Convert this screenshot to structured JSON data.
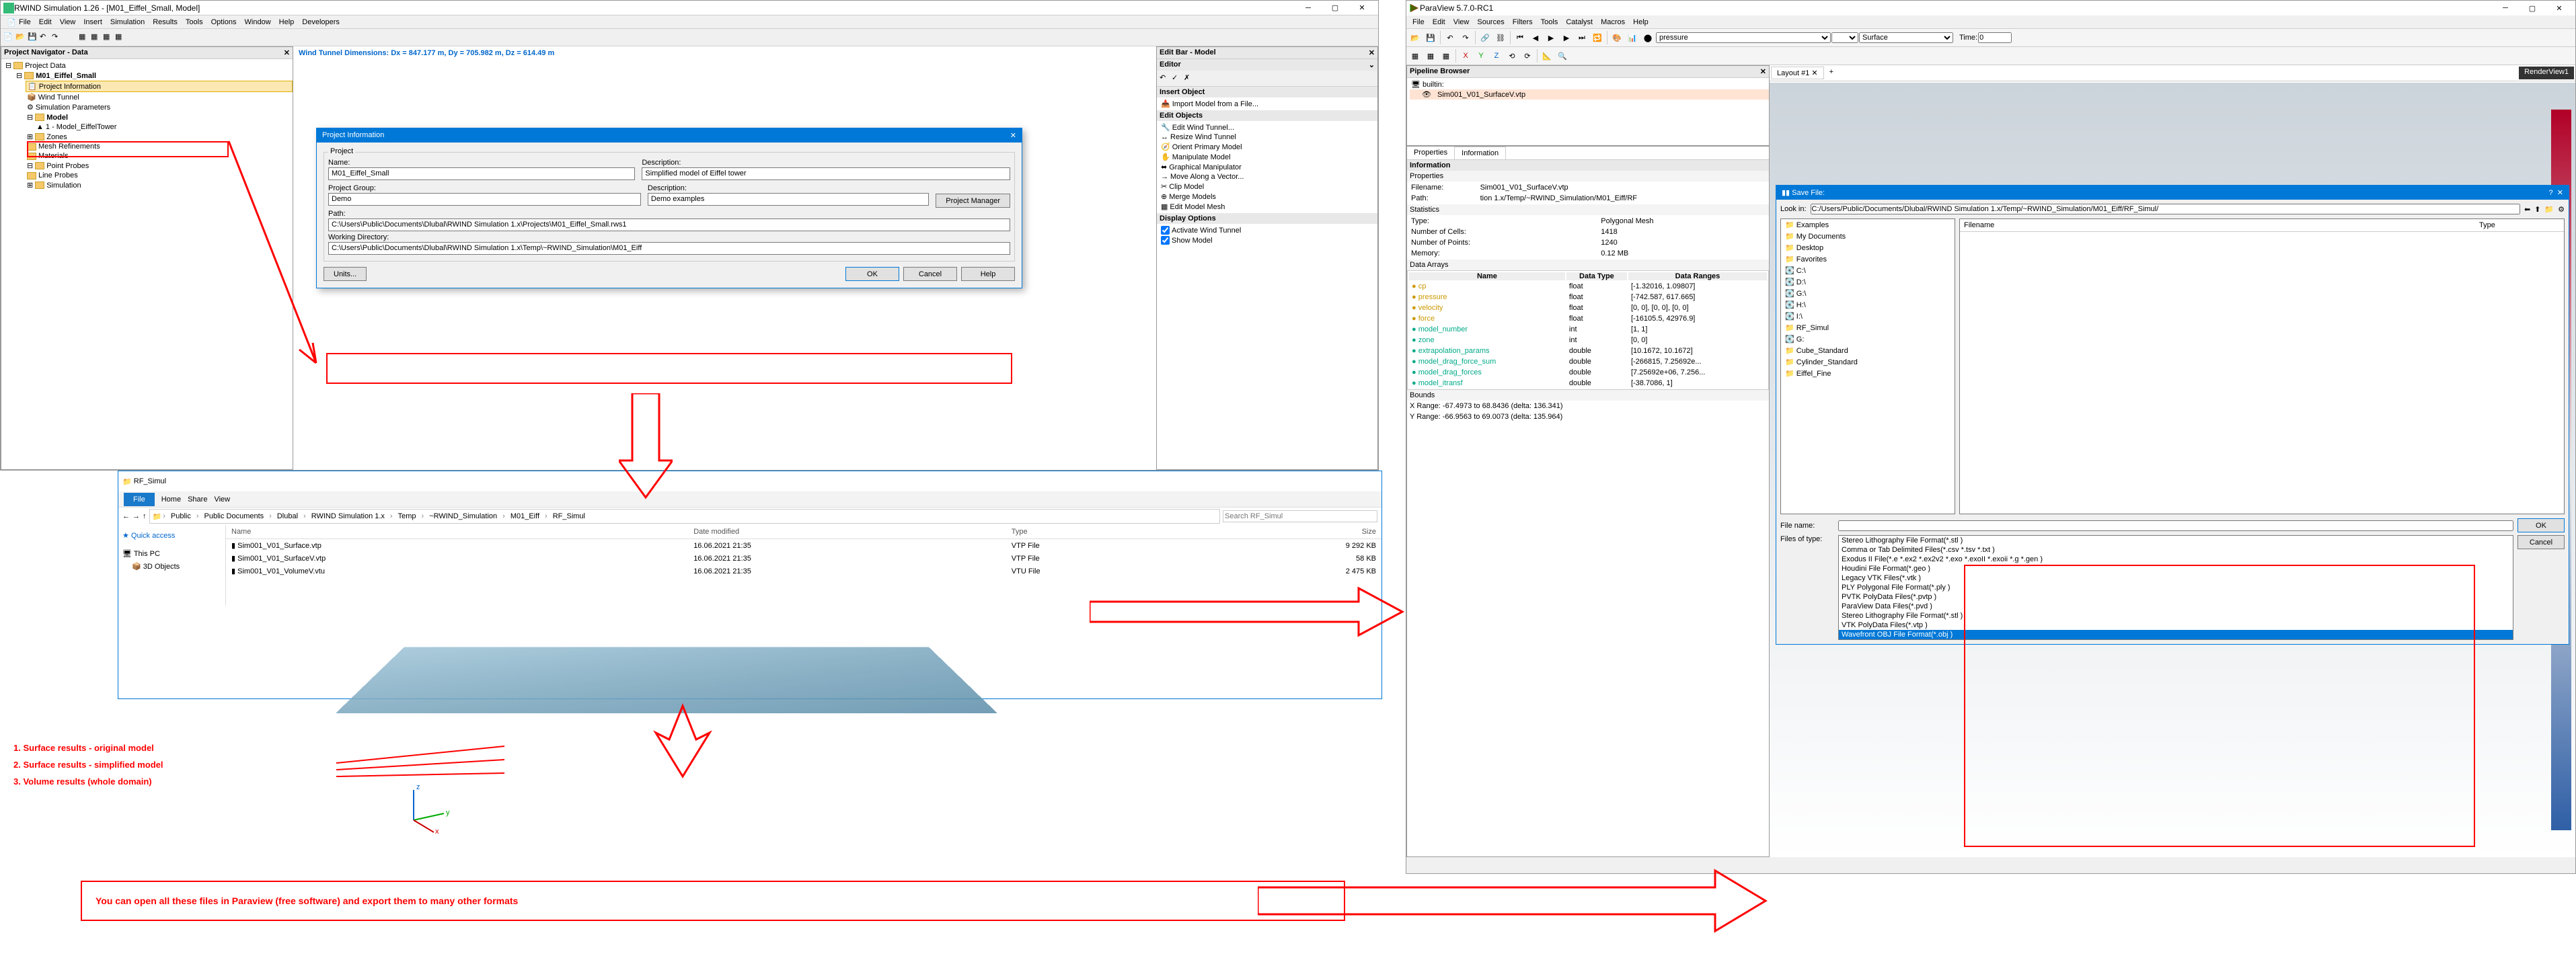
{
  "rwind": {
    "title": "RWIND Simulation 1.26 - [M01_Eiffel_Small, Model]",
    "menus": [
      "File",
      "Edit",
      "View",
      "Insert",
      "Simulation",
      "Results",
      "Tools",
      "Options",
      "Window",
      "Help",
      "Developers"
    ],
    "navigator_title": "Project Navigator - Data",
    "tree_root": "Project Data",
    "tree": [
      "M01_Eiffel_Small",
      "Project Information",
      "Wind Tunnel",
      "Simulation Parameters",
      "Model",
      "1 - Model_EiffelTower",
      "Zones",
      "Mesh Refinements",
      "Materials",
      "Point Probes",
      "Line Probes",
      "Simulation"
    ],
    "wind_dims": "Wind Tunnel Dimensions: Dx = 847.177 m, Dy = 705.982 m, Dz = 614.49 m",
    "editbar_title": "Edit Bar - Model",
    "editor_label": "Editor",
    "insert_label": "Insert Object",
    "insert_items": [
      "Import Model from a File..."
    ],
    "edit_label": "Edit Objects",
    "edit_items": [
      "Edit Wind Tunnel...",
      "Resize Wind Tunnel",
      "Orient Primary Model",
      "Manipulate Model",
      "Graphical Manipulator",
      "Move Along a Vector...",
      "Clip Model",
      "Merge Models",
      "Edit Model Mesh"
    ],
    "display_label": "Display Options",
    "display_items": [
      "Activate Wind Tunnel",
      "Show Model"
    ]
  },
  "proj_dlg": {
    "title": "Project Information",
    "grp": "Project",
    "name_l": "Name:",
    "name": "M01_Eiffel_Small",
    "desc_l": "Description:",
    "desc": "Simplified model of Eiffel tower",
    "pg_l": "Project Group:",
    "pg": "Demo",
    "desc2_l": "Description:",
    "desc2": "Demo examples",
    "pm_btn": "Project Manager",
    "path_l": "Path:",
    "path": "C:\\Users\\Public\\Documents\\Dlubal\\RWIND Simulation 1.x\\Projects\\M01_Eiffel_Small.rws1",
    "wd_l": "Working Directory:",
    "wd": "C:\\Users\\Public\\Documents\\Dlubal\\RWIND Simulation 1.x\\Temp\\~RWIND_Simulation\\M01_Eiff",
    "units": "Units...",
    "ok": "OK",
    "cancel": "Cancel",
    "help": "Help"
  },
  "explorer": {
    "title": "RF_Simul",
    "tabs": [
      "File",
      "Home",
      "Share",
      "View"
    ],
    "crumbs": [
      "Public",
      "Public Documents",
      "Dlubal",
      "RWIND Simulation 1.x",
      "Temp",
      "~RWIND_Simulation",
      "M01_Eiff",
      "RF_Simul"
    ],
    "search_ph": "Search RF_Simul",
    "side": [
      "Quick access",
      "This PC",
      "3D Objects"
    ],
    "cols": [
      "Name",
      "Date modified",
      "Type",
      "Size"
    ],
    "files": [
      {
        "n": "Sim001_V01_Surface.vtp",
        "d": "16.06.2021 21:35",
        "t": "VTP File",
        "s": "9 292 KB"
      },
      {
        "n": "Sim001_V01_SurfaceV.vtp",
        "d": "16.06.2021 21:35",
        "t": "VTP File",
        "s": "58 KB"
      },
      {
        "n": "Sim001_V01_VolumeV.vtu",
        "d": "16.06.2021 21:35",
        "t": "VTU File",
        "s": "2 475 KB"
      }
    ]
  },
  "annot": {
    "a1": "1. Surface results - original model",
    "a2": "2. Surface results - simplified model",
    "a3": "3. Volume results (whole domain)",
    "note": "You can open all these files in Paraview (free software) and export them to many other formats"
  },
  "paraview": {
    "title": "ParaView 5.7.0-RC1",
    "menus": [
      "File",
      "Edit",
      "View",
      "Sources",
      "Filters",
      "Tools",
      "Catalyst",
      "Macros",
      "Help"
    ],
    "dd_pressure": "pressure",
    "dd_surface": "Surface",
    "time_l": "Time:",
    "time_v": "0",
    "pipe_title": "Pipeline Browser",
    "pipe_items": [
      "builtin:",
      "Sim001_V01_SurfaceV.vtp"
    ],
    "layout": "Layout #1",
    "renderview": "RenderView1",
    "tabs": [
      "Properties",
      "Information"
    ],
    "info_header": "Information",
    "props_header": "Properties",
    "filename_l": "Filename:",
    "filename_v": "Sim001_V01_SurfaceV.vtp",
    "path_l": "Path:",
    "path_v": "tion 1.x/Temp/~RWIND_Simulation/M01_Eiff/RF",
    "stats_header": "Statistics",
    "type_l": "Type:",
    "type_v": "Polygonal Mesh",
    "nc_l": "Number of Cells:",
    "nc_v": "1418",
    "np_l": "Number of Points:",
    "np_v": "1240",
    "mem_l": "Memory:",
    "mem_v": "0.12 MB",
    "da_header": "Data Arrays",
    "da_cols": [
      "Name",
      "Data Type",
      "Data Ranges"
    ],
    "da": [
      {
        "k": "p",
        "n": "cp",
        "t": "float",
        "r": "[-1.32016, 1.09807]"
      },
      {
        "k": "p",
        "n": "pressure",
        "t": "float",
        "r": "[-742.587, 617.665]"
      },
      {
        "k": "p",
        "n": "velocity",
        "t": "float",
        "r": "[0, 0], [0, 0], [0, 0]"
      },
      {
        "k": "p",
        "n": "force",
        "t": "float",
        "r": "[-16105.5, 42976.9]"
      },
      {
        "k": "c",
        "n": "model_number",
        "t": "int",
        "r": "[1, 1]"
      },
      {
        "k": "c",
        "n": "zone",
        "t": "int",
        "r": "[0, 0]"
      },
      {
        "k": "c",
        "n": "extrapolation_params",
        "t": "double",
        "r": "[10.1672, 10.1672]"
      },
      {
        "k": "c",
        "n": "model_drag_force_sum",
        "t": "double",
        "r": "[-266815, 7.25692e..."
      },
      {
        "k": "c",
        "n": "model_drag_forces",
        "t": "double",
        "r": "[7.25692e+06, 7.256..."
      },
      {
        "k": "c",
        "n": "model_itransf",
        "t": "double",
        "r": "[-38.7086, 1]"
      }
    ],
    "bounds_header": "Bounds",
    "xr": "X Range: -67.4973 to 68.8436 (delta: 136.341)",
    "yr": "Y Range: -66.9563 to 69.0073 (delta: 135.964)"
  },
  "savefile": {
    "title": "Save File:",
    "lookin_l": "Look in:",
    "lookin_v": "C:/Users/Public/Documents/Dlubal/RWIND Simulation 1.x/Temp/~RWIND_Simulation/M01_Eiff/RF_Simul/",
    "col_fn": "Filename",
    "col_t": "Type",
    "places": [
      "Examples",
      "My Documents",
      "Desktop",
      "Favorites",
      "C:\\",
      "D:\\",
      "G:\\",
      "H:\\",
      "I:\\",
      "RF_Simul",
      "G:",
      "Cube_Standard",
      "Cylinder_Standard",
      "Eiffel_Fine"
    ],
    "fn_l": "File name:",
    "ft_l": "Files of type:",
    "ok": "OK",
    "cancel": "Cancel",
    "formats": [
      "Stereo Lithography File Format(*.stl )",
      "Comma or Tab Delimited Files(*.csv *.tsv *.txt )",
      "Exodus II File(*.e *.ex2 *.ex2v2 *.exo *.exoII *.exoii *.g *.gen )",
      "Houdini File Format(*.geo )",
      "Legacy VTK Files(*.vtk )",
      "PLY Polygonal File Format(*.ply )",
      "PVTK PolyData Files(*.pvtp )",
      "ParaView Data Files(*.pvd )",
      "Stereo Lithography File Format(*.stl )",
      "VTK PolyData Files(*.vtp )",
      "Wavefront OBJ File Format(*.obj )"
    ]
  }
}
